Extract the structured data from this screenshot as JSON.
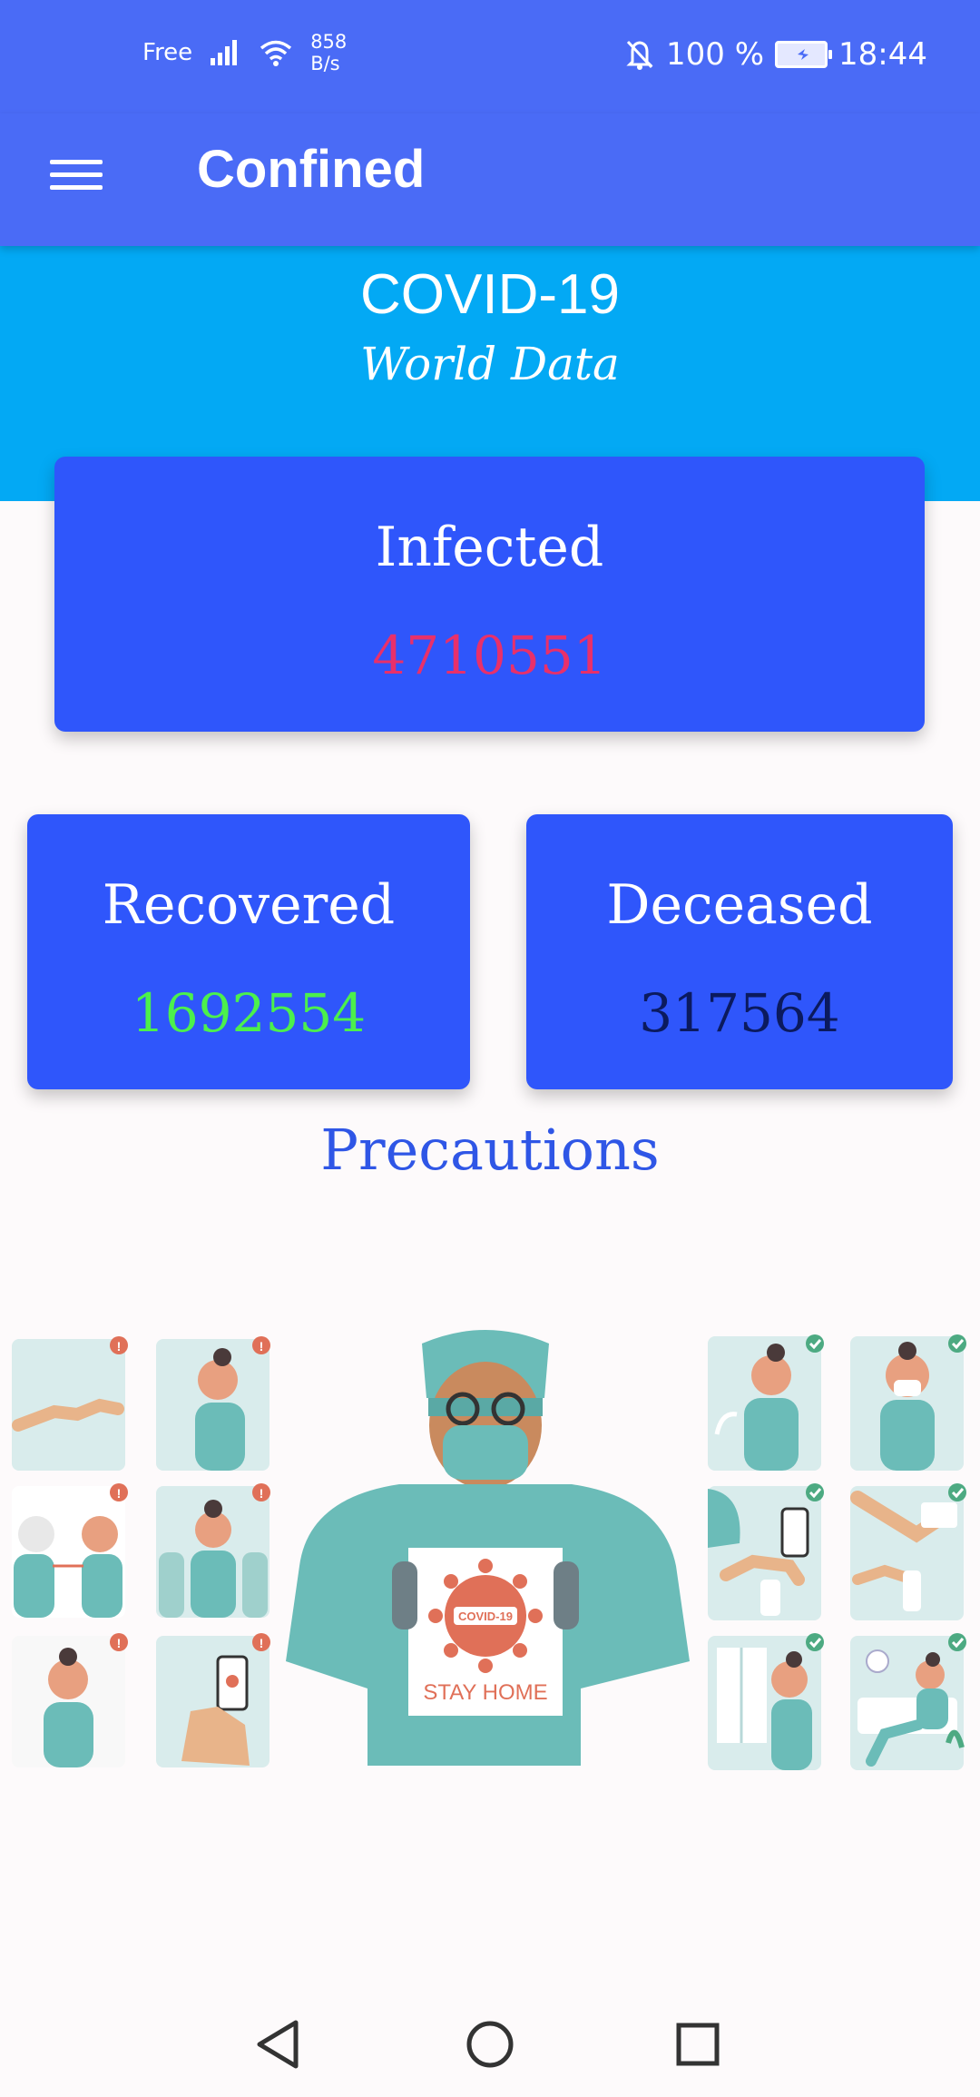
{
  "status_bar": {
    "carrier": "Free",
    "net_speed_value": "858",
    "net_speed_unit": "B/s",
    "battery_percent": "100 %",
    "time": "18:44",
    "icons": [
      "signal-icon",
      "wifi-icon",
      "notifications-off-icon",
      "battery-charging-icon"
    ]
  },
  "app_bar": {
    "title": "Confined",
    "menu_icon": "hamburger-menu-icon"
  },
  "header": {
    "title": "COVID-19",
    "subtitle": "World Data"
  },
  "stats": {
    "infected": {
      "label": "Infected",
      "value": "4710551",
      "value_color": "#e8306a"
    },
    "recovered": {
      "label": "Recovered",
      "value": "1692554",
      "value_color": "#4cf04c"
    },
    "deceased": {
      "label": "Deceased",
      "value": "317564",
      "value_color": "#0b1a5e"
    }
  },
  "precautions": {
    "title": "Precautions",
    "title_color": "#2f56e6",
    "poster_line1": "COVID-19",
    "poster_line2": "STAY HOME"
  },
  "colors": {
    "primary": "#4a6bf6",
    "hero": "#03a9f4",
    "card": "#2f56fb"
  },
  "nav_bar": {
    "icons": [
      "back-icon",
      "home-icon",
      "recents-icon"
    ]
  }
}
